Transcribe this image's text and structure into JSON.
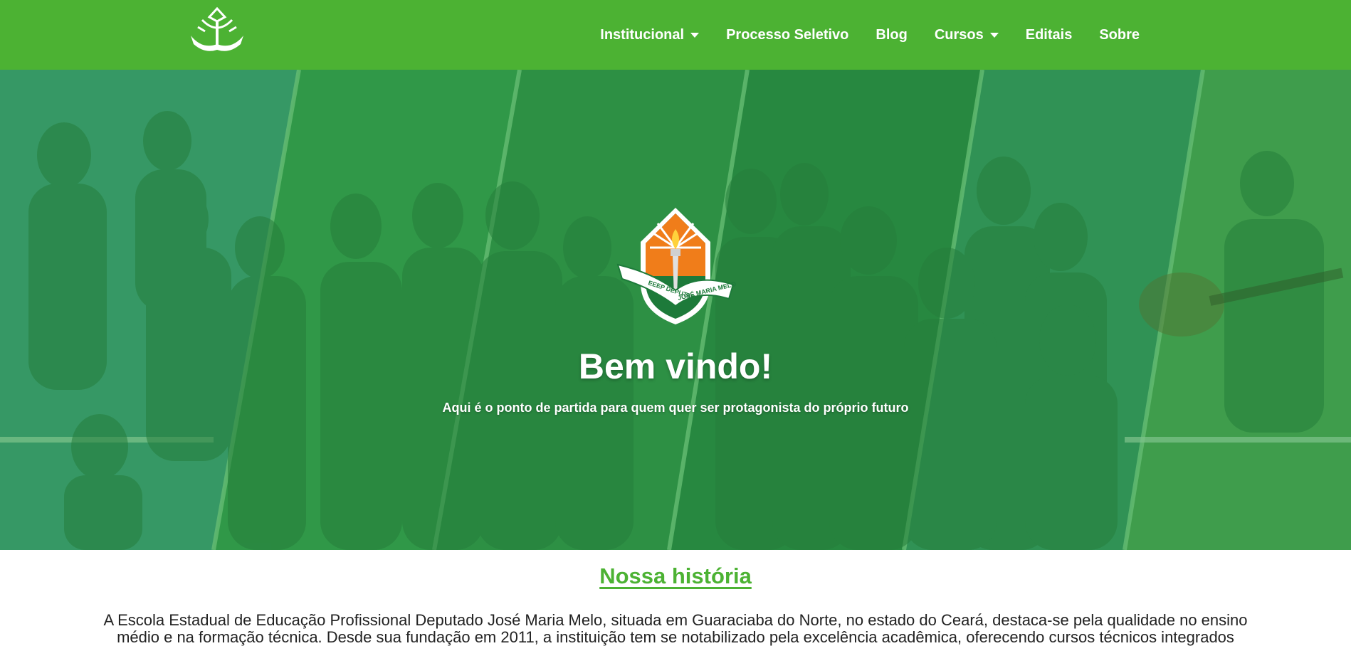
{
  "header": {
    "nav": [
      {
        "label": "Institucional",
        "dropdown": true
      },
      {
        "label": "Processo Seletivo",
        "dropdown": false
      },
      {
        "label": "Blog",
        "dropdown": false
      },
      {
        "label": "Cursos",
        "dropdown": true
      },
      {
        "label": "Editais",
        "dropdown": false
      },
      {
        "label": "Sobre",
        "dropdown": false
      }
    ],
    "logo_icon": "school-emblem-white"
  },
  "hero": {
    "title": "Bem vindo!",
    "subtitle": "Aqui é o ponto de partida para quem quer ser protagonista do próprio futuro",
    "crest_text_1": "EEEP DEPUTADO",
    "crest_text_2": "JOSÉ MARIA MELO"
  },
  "history": {
    "title": "Nossa história",
    "text": "A Escola Estadual de Educação Profissional Deputado José Maria Melo, situada em Guaraciaba do Norte, no estado do Ceará, destaca-se pela qualidade no ensino médio e na formação técnica. Desde sua fundação em 2011, a instituição tem se notabilizado pela excelência acadêmica, oferecendo cursos técnicos integrados"
  },
  "colors": {
    "brand_green": "#4cb233",
    "hero_overlay": "#1e963c",
    "crest_dark_green": "#1d7a3a",
    "crest_orange": "#f07d1a"
  }
}
